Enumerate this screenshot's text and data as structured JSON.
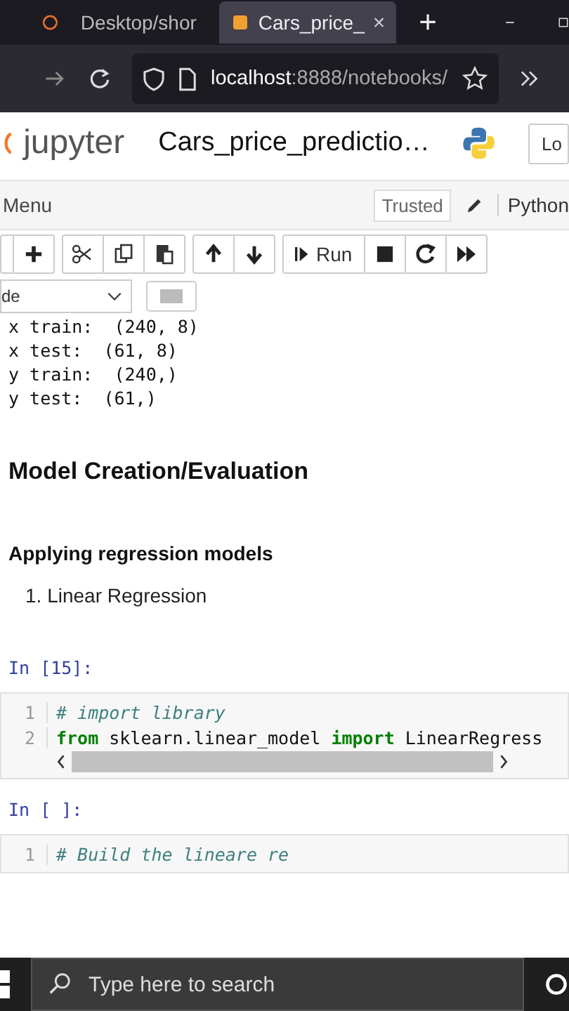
{
  "browser": {
    "tabs": [
      {
        "title": "Desktop/shor",
        "selected": false
      },
      {
        "title": "Cars_price_",
        "selected": true,
        "close": "×"
      }
    ],
    "new_tab": "+",
    "url": {
      "host": "localhost",
      "path": ":8888/notebooks/"
    }
  },
  "notebook": {
    "logo": "jupyter",
    "title": "Cars_price_predictio…",
    "logout": "Lo",
    "menu": "Menu",
    "trusted": "Trusted",
    "kernel": "Python",
    "run": "Run",
    "cell_type": "de"
  },
  "output": [
    "x train:  (240, 8)",
    "x test:  (61, 8)",
    "y train:  (240,)",
    "y test:  (61,)"
  ],
  "heading": "Model Creation/Evaluation",
  "subheading": "Applying regression models",
  "list": [
    {
      "number": "1.",
      "text": "Linear Regression"
    }
  ],
  "cells": [
    {
      "prompt": "In [15]:",
      "scrollbar": true,
      "lines": [
        {
          "number": "1",
          "tokens": [
            {
              "kind": "comment",
              "text": "# import library"
            }
          ]
        },
        {
          "number": "2",
          "tokens": [
            {
              "kind": "keyword",
              "text": "from"
            },
            {
              "kind": "plain",
              "text": " sklearn.linear_model "
            },
            {
              "kind": "keyword",
              "text": "import"
            },
            {
              "kind": "plain",
              "text": " LinearRegress"
            }
          ]
        }
      ]
    },
    {
      "prompt": "In [ ]:",
      "scrollbar": false,
      "lines": [
        {
          "number": "1",
          "tokens": [
            {
              "kind": "comment",
              "text": "# Build the lineare re"
            }
          ]
        }
      ]
    }
  ],
  "taskbar": {
    "search_placeholder": "Type here to search"
  }
}
